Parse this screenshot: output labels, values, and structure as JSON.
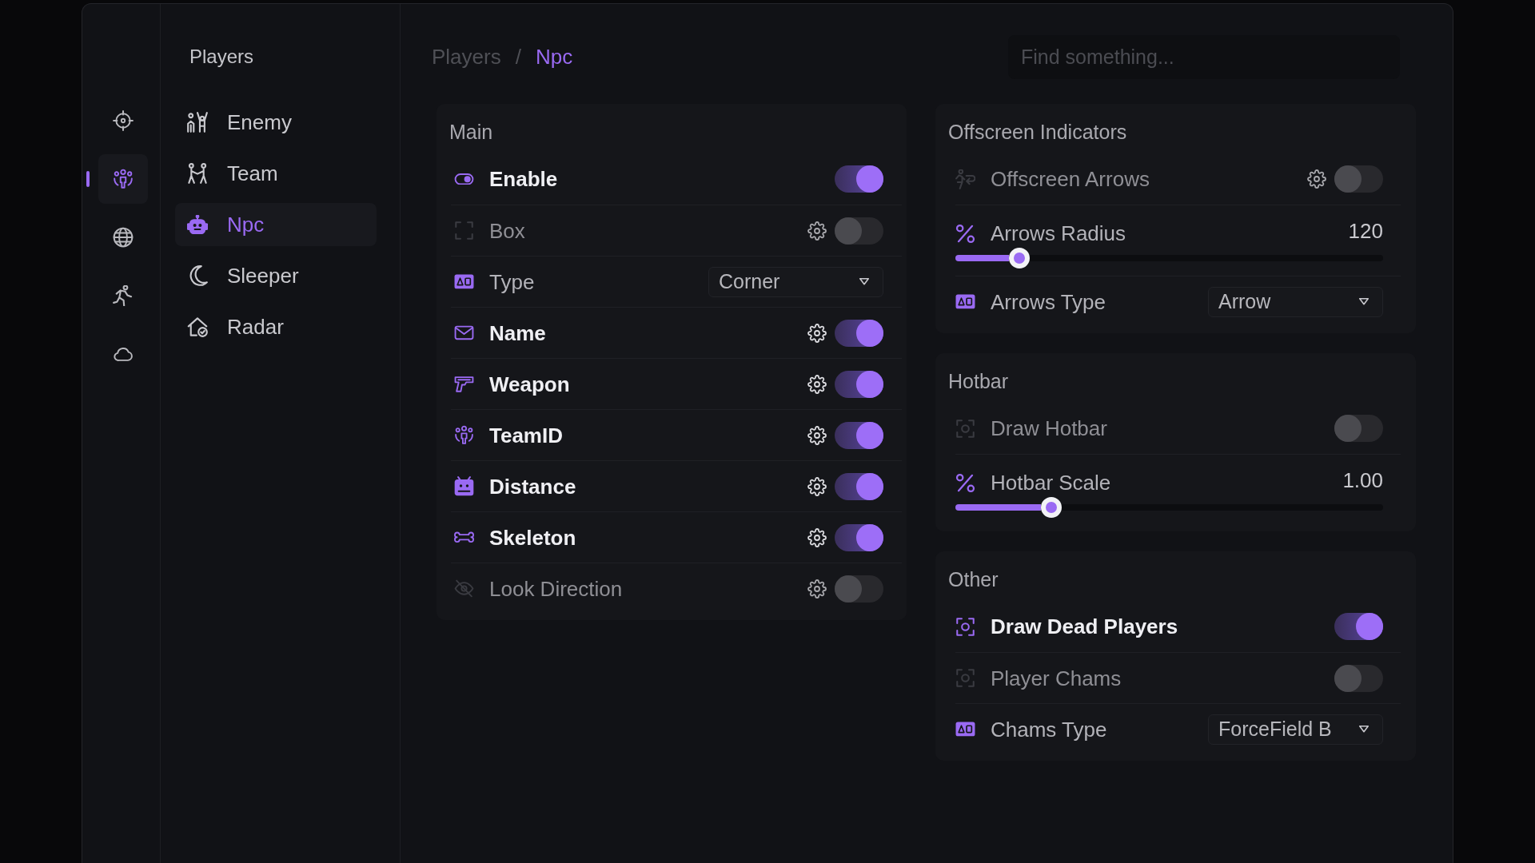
{
  "rail": [
    {
      "selected": false
    },
    {
      "selected": true
    },
    {
      "selected": false
    },
    {
      "selected": false
    },
    {
      "selected": false
    }
  ],
  "nav": {
    "title": "Players",
    "items": [
      {
        "label": "Enemy",
        "selected": false
      },
      {
        "label": "Team",
        "selected": false
      },
      {
        "label": "Npc",
        "selected": true
      },
      {
        "label": "Sleeper",
        "selected": false
      },
      {
        "label": "Radar",
        "selected": false
      }
    ]
  },
  "breadcrumb": {
    "items": [
      {
        "label": "Players",
        "current": false
      },
      {
        "label": "Npc",
        "current": true
      }
    ],
    "separator": "/"
  },
  "search": {
    "placeholder": "Find something..."
  },
  "columns": [
    [
      {
        "title": "Main",
        "rows": [
          {
            "kind": "toggle",
            "label": "Enable",
            "on": true,
            "gear": false
          },
          {
            "kind": "toggle",
            "label": "Box",
            "on": false,
            "gear": true
          },
          {
            "kind": "dropdown",
            "label": "Type",
            "value": "Corner"
          },
          {
            "kind": "toggle",
            "label": "Name",
            "on": true,
            "gear": true
          },
          {
            "kind": "toggle",
            "label": "Weapon",
            "on": true,
            "gear": true
          },
          {
            "kind": "toggle",
            "label": "TeamID",
            "on": true,
            "gear": true
          },
          {
            "kind": "toggle",
            "label": "Distance",
            "on": true,
            "gear": true
          },
          {
            "kind": "toggle",
            "label": "Skeleton",
            "on": true,
            "gear": true
          },
          {
            "kind": "toggle",
            "label": "Look Direction",
            "on": false,
            "gear": true
          }
        ]
      }
    ],
    [
      {
        "title": "Offscreen Indicators",
        "rows": [
          {
            "kind": "toggle",
            "label": "Offscreen Arrows",
            "on": false,
            "gear": true
          },
          {
            "kind": "slider",
            "label": "Arrows Radius",
            "reading": "120",
            "level": 0.15
          },
          {
            "kind": "dropdown",
            "label": "Arrows Type",
            "value": "Arrow"
          }
        ]
      },
      {
        "title": "Hotbar",
        "rows": [
          {
            "kind": "toggle",
            "label": "Draw Hotbar",
            "on": false,
            "gear": false
          },
          {
            "kind": "slider",
            "label": "Hotbar Scale",
            "reading": "1.00",
            "level": 0.225
          }
        ]
      },
      {
        "title": "Other",
        "rows": [
          {
            "kind": "toggle",
            "label": "Draw Dead Players",
            "on": true,
            "gear": false
          },
          {
            "kind": "toggle",
            "label": "Player Chams",
            "on": false,
            "gear": false
          },
          {
            "kind": "dropdown",
            "label": "Chams Type",
            "value": "ForceField B"
          }
        ]
      }
    ]
  ]
}
